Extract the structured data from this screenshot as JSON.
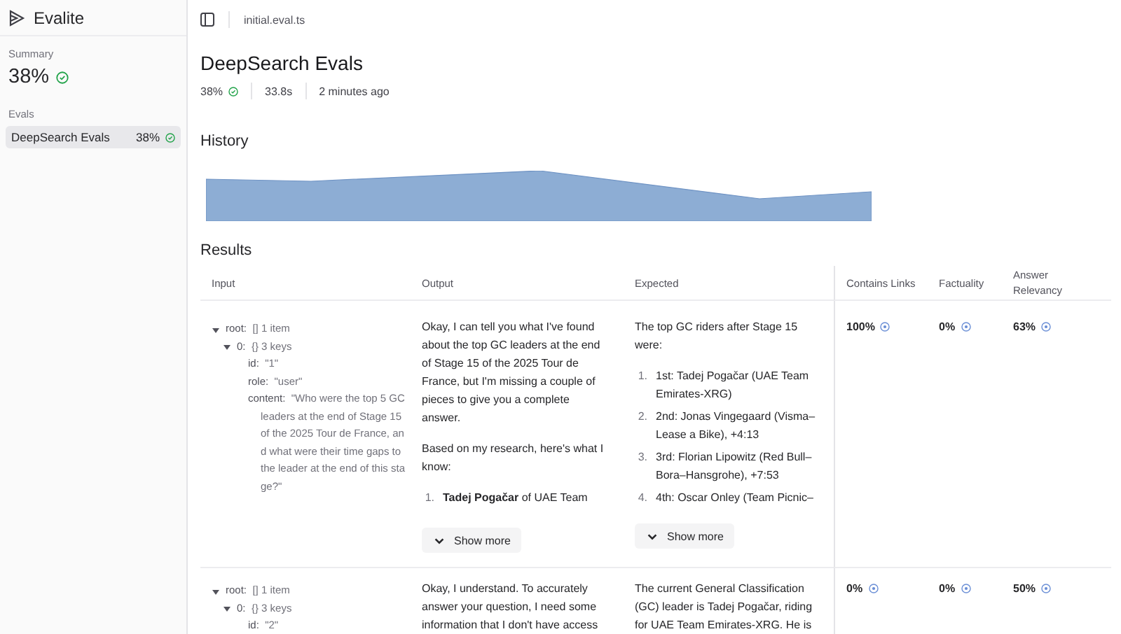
{
  "sidebar": {
    "app_name": "Evalite",
    "summary_label": "Summary",
    "summary_score": "38%",
    "evals_label": "Evals",
    "items": [
      {
        "name": "DeepSearch Evals",
        "score": "38%",
        "selected": true
      }
    ]
  },
  "topbar": {
    "file": "initial.eval.ts"
  },
  "eval": {
    "title": "DeepSearch Evals",
    "score": "38%",
    "duration": "33.8s",
    "time_ago": "2 minutes ago"
  },
  "history": {
    "title": "History"
  },
  "results": {
    "title": "Results",
    "columns": [
      "Input",
      "Output",
      "Expected",
      "Contains Links",
      "Factuality",
      "Answer Relevancy"
    ],
    "rows": [
      {
        "input": [
          {
            "key": "root:",
            "summary": "[] 1 item",
            "expanded": true,
            "children": [
              {
                "key": "0:",
                "summary": "{} 3 keys",
                "expanded": true,
                "children": [
                  {
                    "key": "id:",
                    "value": "\"1\""
                  },
                  {
                    "key": "role:",
                    "value": "\"user\""
                  },
                  {
                    "key": "content:",
                    "value": "\"Who were the top 5 GC leaders at the end of Stage 15 of the 2025 Tour de France, and what were their time gaps to the leader at the end of this stage?\""
                  }
                ]
              }
            ]
          }
        ],
        "output": [
          {
            "kind": "paragraph",
            "text": "Okay, I can tell you what I've found about the top GC leaders at the end of Stage 15 of the 2025 Tour de France, but I'm missing a couple of pieces to give you a complete answer."
          },
          {
            "kind": "paragraph",
            "text": "Based on my research, here's what I know:"
          },
          {
            "kind": "list",
            "items": [
              {
                "number": "1.",
                "text": "**Tadej Pogačar** of UAE Team"
              }
            ]
          }
        ],
        "output_more": "Show more",
        "expected": [
          {
            "kind": "paragraph",
            "text": "The top GC riders after Stage 15 were:"
          },
          {
            "kind": "list",
            "items": [
              {
                "number": "1.",
                "text": "1st: Tadej Pogačar (UAE Team Emirates-XRG)"
              },
              {
                "number": "2.",
                "text": "2nd: Jonas Vingegaard (Visma–Lease a Bike), +4:13"
              },
              {
                "number": "3.",
                "text": "3rd: Florian Lipowitz (Red Bull–Bora–Hansgrohe), +7:53"
              },
              {
                "number": "4.",
                "text": "4th: Oscar Onley (Team Picnic–"
              }
            ]
          }
        ],
        "expected_more": "Show more",
        "scores": [
          "100%",
          "0%",
          "63%"
        ]
      },
      {
        "input": [
          {
            "key": "root:",
            "summary": "[] 1 item",
            "expanded": true,
            "children": [
              {
                "key": "0:",
                "summary": "{} 3 keys",
                "expanded": true,
                "children": [
                  {
                    "key": "id:",
                    "value": "\"2\""
                  }
                ]
              }
            ]
          }
        ],
        "output": [
          {
            "kind": "paragraph",
            "text": "Okay, I understand. To accurately answer your question, I need some information that I don't have access"
          }
        ],
        "expected": [
          {
            "kind": "paragraph",
            "text": "The current General Classification (GC) leader is Tadej Pogačar, riding for UAE Team Emirates-XRG. He is"
          }
        ],
        "scores": [
          "0%",
          "0%",
          "50%"
        ]
      }
    ]
  }
}
